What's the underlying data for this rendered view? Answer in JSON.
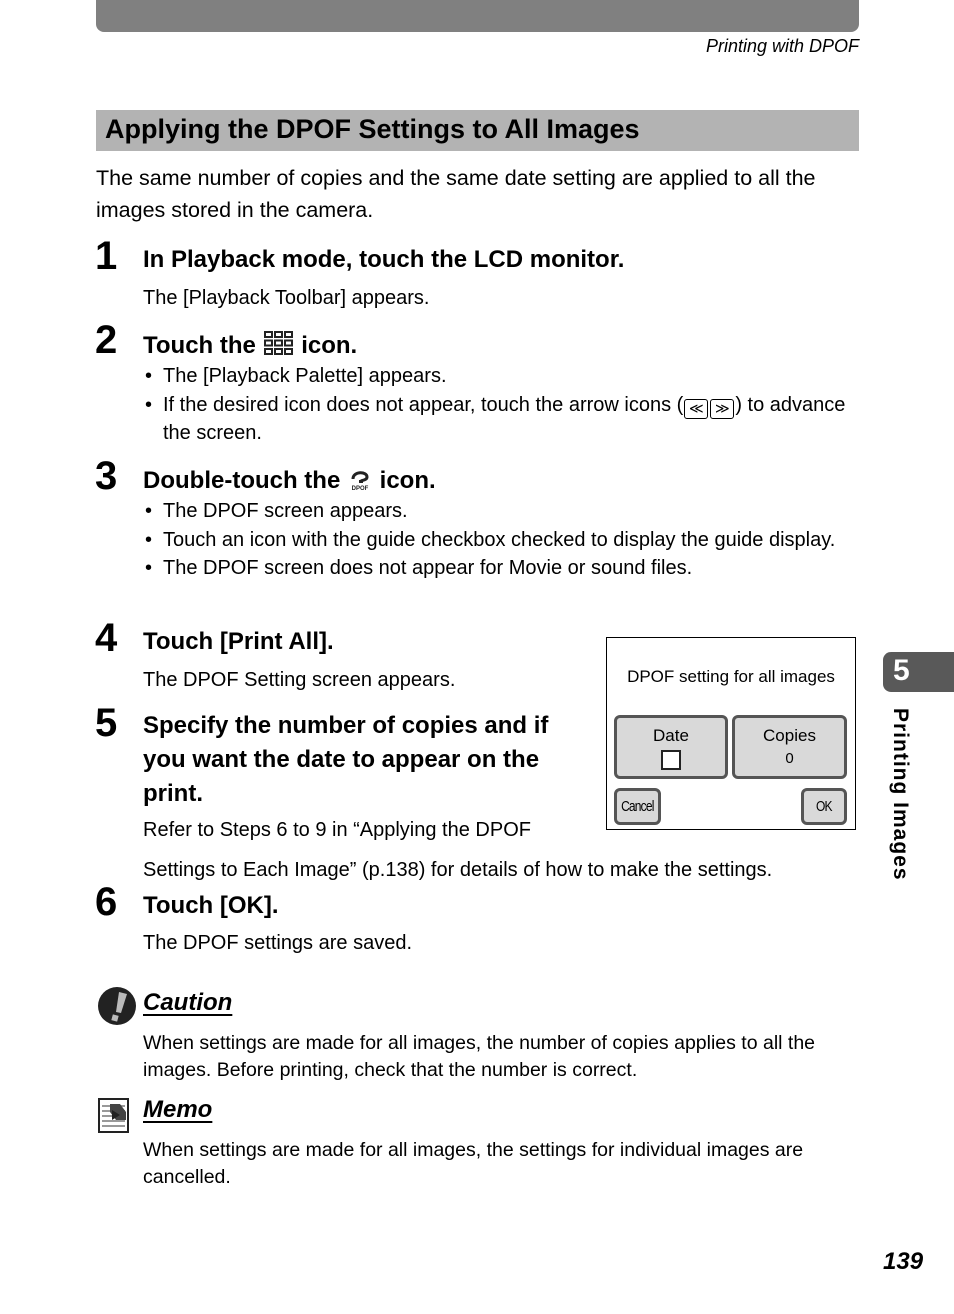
{
  "header": {
    "running_head": "Printing with DPOF"
  },
  "section": {
    "title": "Applying the DPOF Settings to All Images",
    "intro": "The same number of copies and the same date setting are applied to all the images stored in the camera."
  },
  "steps": [
    {
      "number": "1",
      "title": "In Playback mode, touch the LCD monitor.",
      "body": "The [Playback Toolbar] appears."
    },
    {
      "number": "2",
      "title_before_icon": "Touch the",
      "icon": "mode-palette-icon",
      "title_after_icon": "icon.",
      "bullets": [
        "The [Playback Palette] appears.",
        "If the desired icon does not appear, touch the arrow icons (",
        ") to advance the screen."
      ],
      "arrow_left": "≪",
      "arrow_right": "≫"
    },
    {
      "number": "3",
      "title_before_icon": "Double-touch the",
      "icon": "dpof-icon",
      "title_after_icon": "icon.",
      "bullets": [
        "The DPOF screen appears.",
        "Touch an icon with the guide checkbox checked to display the guide display.",
        "The DPOF screen does not appear for Movie or sound files."
      ]
    },
    {
      "number": "4",
      "title": "Touch [Print All].",
      "body": "The DPOF Setting screen appears."
    },
    {
      "number": "5",
      "title": "Specify the number of copies and if you want the date to appear on the print.",
      "body": "Refer to Steps 6 to 9 in “Applying the DPOF Settings to Each Image” (p.138) for details of how to make the settings."
    },
    {
      "number": "6",
      "title": "Touch [OK].",
      "body": "The DPOF settings are saved."
    }
  ],
  "lcd_screen": {
    "title": "DPOF setting for all images",
    "date_label": "Date",
    "date_checked": false,
    "copies_label": "Copies",
    "copies_value": "0",
    "cancel_label": "Cancel",
    "ok_label": "OK"
  },
  "caution": {
    "heading": "Caution",
    "text": "When settings are made for all images, the number of copies applies to all the images. Before printing, check that the number is correct."
  },
  "memo": {
    "heading": "Memo",
    "text": "When settings are made for all images, the settings for individual images are cancelled."
  },
  "chapter_tab": {
    "number": "5",
    "label": "Printing Images"
  },
  "page_number": "139"
}
